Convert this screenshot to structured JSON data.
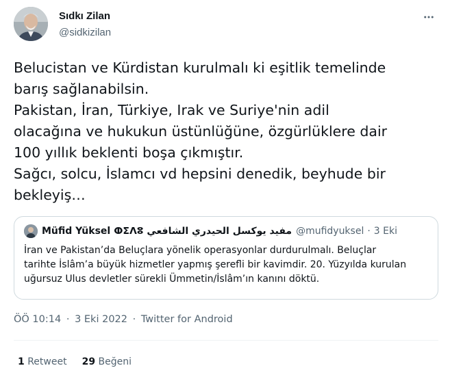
{
  "author": {
    "name": "Sıdkı Zilan",
    "handle": "@sidkizilan"
  },
  "tweet": {
    "lines": [
      "Belucistan ve Kürdistan kurulmalı ki eşitlik temelinde",
      "barış sağlanabilsin.",
      "Pakistan, İran, Türkiye, Irak ve Suriye'nin adil",
      "olacağına ve hukukun üstünlüğüne, özgürlüklere dair",
      "100 yıllık beklenti boşa çıkmıştır.",
      "Sağcı, solcu, İslamcı vd hepsini denedik, beyhude bir",
      "bekleyiş…"
    ]
  },
  "quote": {
    "name": "Müfid Yüksel",
    "name_rtl": "ⵀⵉⴷⵓ مفيد يوكسل الحيدري الشافعي",
    "handle": "@mufidyuksel",
    "separator": "·",
    "date": "3 Eki",
    "lines": [
      "İran ve Pakistan’da Beluçlara yönelik operasyonlar durdurulmalı. Beluçlar",
      "tarihte İslâm’a büyük hizmetler yapmış şerefli bir kavimdir. 20. Yüzyılda kurulan",
      "uğursuz Ulus devletler sürekli Ümmetin/İslâm’ın kanını döktü."
    ]
  },
  "meta": {
    "time": "ÖÖ 10:14",
    "separator": "·",
    "date": "3 Eki 2022",
    "source": "Twitter for Android"
  },
  "stats": {
    "retweet_count": "1",
    "retweet_label": "Retweet",
    "like_count": "29",
    "like_label": "Beğeni"
  },
  "icons": {
    "more": "more-horizontal-icon"
  },
  "colors": {
    "text": "#0f1419",
    "secondary": "#536471",
    "border": "#cfd9de"
  }
}
